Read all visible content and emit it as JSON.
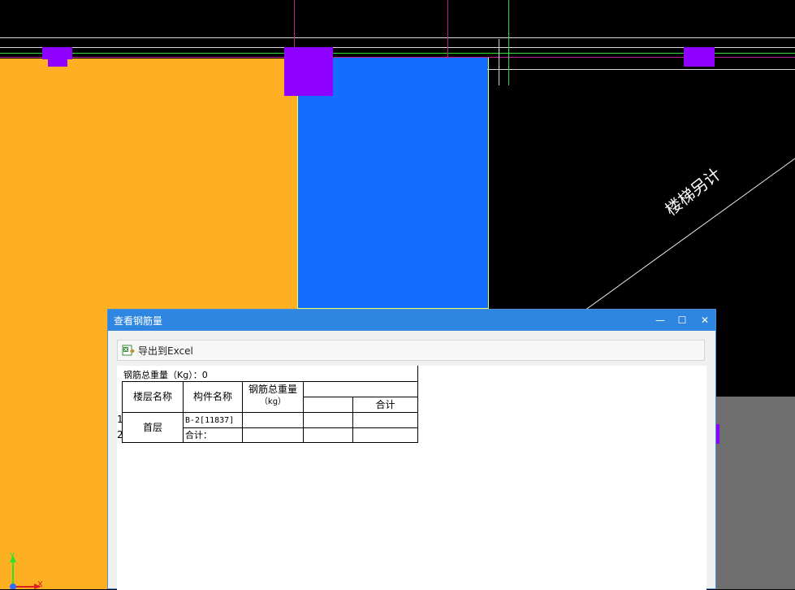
{
  "cad": {
    "stair_label": "楼梯另计",
    "axis_y_label": "Y",
    "axis_x_label": "X"
  },
  "dialog": {
    "title": "查看钢筋量",
    "minimize_label": "—",
    "maximize_label": "☐",
    "close_label": "✕",
    "export_label": "导出到Excel",
    "report": {
      "total_weight_label": "钢筋总重量（Kg）：0",
      "headers": {
        "floor_name": "楼层名称",
        "component_name": "构件名称",
        "total_weight_line1": "钢筋总重量",
        "total_weight_line2": "（kg）",
        "subtotal": "合计"
      },
      "rows": [
        {
          "index": "1",
          "floor": "首层",
          "component": "B-2[11837]"
        },
        {
          "index": "2",
          "component": "合计："
        }
      ]
    }
  }
}
